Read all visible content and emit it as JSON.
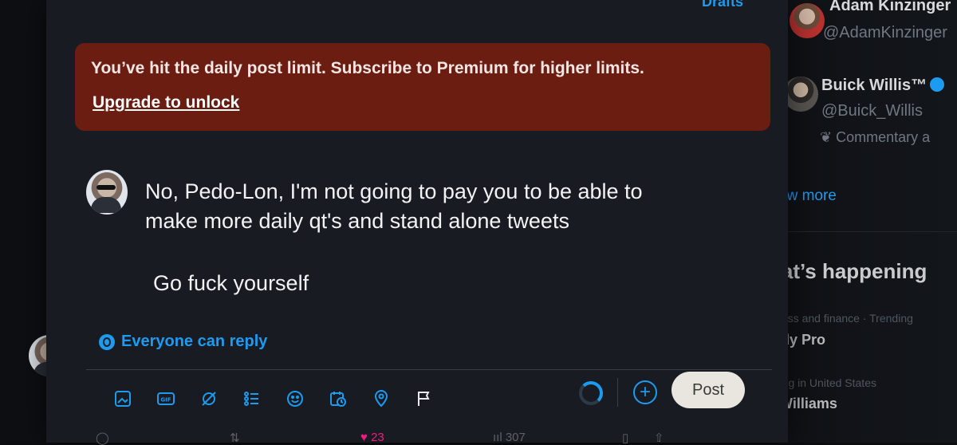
{
  "modal": {
    "top_link": "Drafts",
    "banner": {
      "message": "You’ve hit the daily post limit. Subscribe to Premium for higher limits.",
      "link": "Upgrade to unlock"
    },
    "post_lines": [
      "No, Pedo-Lon, I'm not going to pay you to be able to",
      "make more daily qt's and stand alone tweets"
    ],
    "post_line_3": "Go fuck yourself",
    "reply_setting": "Everyone can reply",
    "post_button": "Post",
    "add_button": "+",
    "toolbar_icons": [
      "image-icon",
      "gif-icon",
      "grok-icon",
      "poll-icon",
      "emoji-icon",
      "schedule-icon",
      "location-icon",
      "flag-icon"
    ]
  },
  "sidebar": {
    "accounts": [
      {
        "name": "Adam Kinzinger",
        "handle": "@AdamKinzinger"
      },
      {
        "name": "Buick Willis™",
        "handle": "@Buick_Willis",
        "bio": "Commentary a"
      }
    ],
    "show_more": "ow more",
    "heading": "hat’s happening",
    "trends": [
      {
        "context": "siness and finance · Trending",
        "name": "ardy Pro"
      },
      {
        "context": "nding in United States",
        "name": "y Williams"
      }
    ]
  },
  "bottom_actions": {
    "likes": "23",
    "views": "307"
  },
  "colors": {
    "accent": "#1d9bf0",
    "banner": "#6b1d12",
    "modal_bg": "#181b21"
  }
}
